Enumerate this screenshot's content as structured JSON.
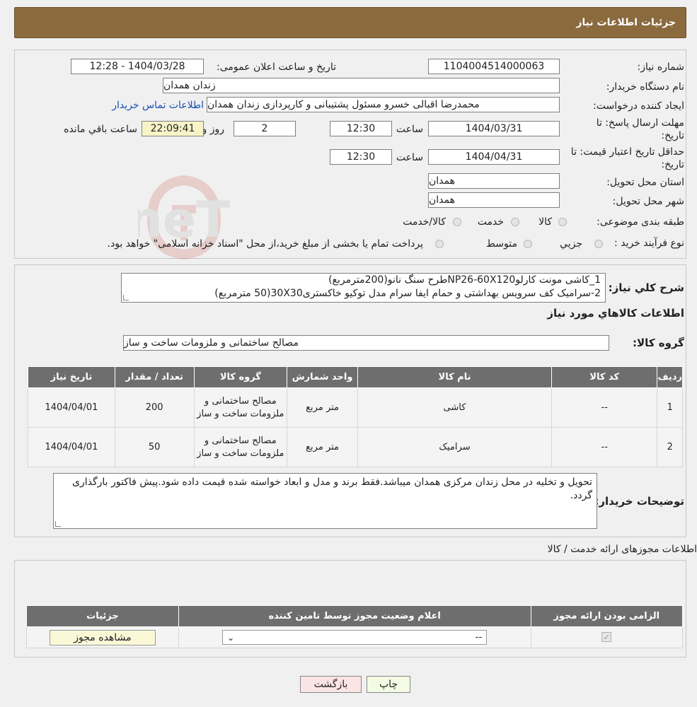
{
  "header": {
    "title": "جزئیات اطلاعات نیاز"
  },
  "fields": {
    "need_number_label": "شماره نیاز:",
    "need_number": "1104004514000063",
    "announce_label": "تاریخ و ساعت اعلان عمومی:",
    "announce_value": "1404/03/28 - 12:28",
    "buyer_org_label": "نام دستگاه خریدار:",
    "buyer_org": "زندان همدان",
    "creator_label": "ایجاد کننده درخواست:",
    "creator": "محمدرضا اقبالی خسرو مسئول پشتیبانی و کارپردازی زندان همدان",
    "contact_link": "اطلاعات تماس خریدار",
    "deadline_label_1": "مهلت ارسال پاسخ: تا",
    "deadline_label_2": "تاریخ:",
    "deadline_date": "1404/03/31",
    "time_label": "ساعت",
    "deadline_time": "12:30",
    "days_value": "2",
    "days_label": "روز و",
    "remaining_value": "22:09:41",
    "remaining_label": "ساعت باقي مانده",
    "validity_label_1": "حداقل تاریخ اعتبار قیمت: تا",
    "validity_label_2": "تاریخ:",
    "validity_date": "1404/04/31",
    "validity_time": "12:30",
    "province_label": "استان محل تحویل:",
    "province": "همدان",
    "city_label": "شهر محل تحویل:",
    "city": "همدان",
    "category_label": "طبقه بندی موضوعی:",
    "category_options": [
      "کالا",
      "خدمت",
      "کالا/خدمت"
    ],
    "process_label": "نوع فرآیند خرید :",
    "process_options": [
      "جزیي",
      "متوسط"
    ],
    "process_note": "پرداخت تمام یا بخشی از مبلغ خرید،از محل \"اسناد خزانه اسلامی\" خواهد بود."
  },
  "summary": {
    "label": "شرح كلي نیاز:",
    "line1": "1_کاشی مونت کارلوNP26-60X120طرح سنگ نانو(200مترمربع)",
    "line2": "2-سرامیک کف سرویس بهداشتی و حمام ایفا سرام مدل توکیو خاکستری30X30(50 مترمربع)"
  },
  "goods": {
    "section_title": "اطلاعات کالاهاي مورد نیاز",
    "group_label": "گروه کالا:",
    "group_value": "مصالح ساختمانی و ملزومات ساخت و ساز",
    "columns": [
      "رديف",
      "کد کالا",
      "نام کالا",
      "واحد شمارش",
      "گروه کالا",
      "تعداد / مقدار",
      "تاریخ نیاز"
    ],
    "rows": [
      {
        "idx": "1",
        "code": "--",
        "name": "کاشی",
        "unit": "متر مربع",
        "group": "مصالح ساختمانی و ملزومات ساخت و ساز",
        "qty": "200",
        "date": "1404/04/01"
      },
      {
        "idx": "2",
        "code": "--",
        "name": "سرامیک",
        "unit": "متر مربع",
        "group": "مصالح ساختمانی و ملزومات ساخت و ساز",
        "qty": "50",
        "date": "1404/04/01"
      }
    ]
  },
  "buyer_notes": {
    "label": "توضیحات خریدار:",
    "text": "تحویل و تخلیه در محل زندان مرکزی همدان میباشد.فقط برند و مدل و ابعاد خواسته شده قیمت داده شود.پیش فاکتور بارگذاری گردد."
  },
  "licenses": {
    "section_title": "اطلاعات مجوزهای ارائه خدمت / کالا",
    "columns": [
      "الزامی بودن ارائه مجوز",
      "اعلام وضعیت مجوز توسط تامین کننده",
      "جزئیات"
    ],
    "select_value": "--",
    "view_button": "مشاهده مجوز"
  },
  "actions": {
    "print": "چاپ",
    "back": "بازگشت"
  },
  "watermark": "AriaTender.neT"
}
